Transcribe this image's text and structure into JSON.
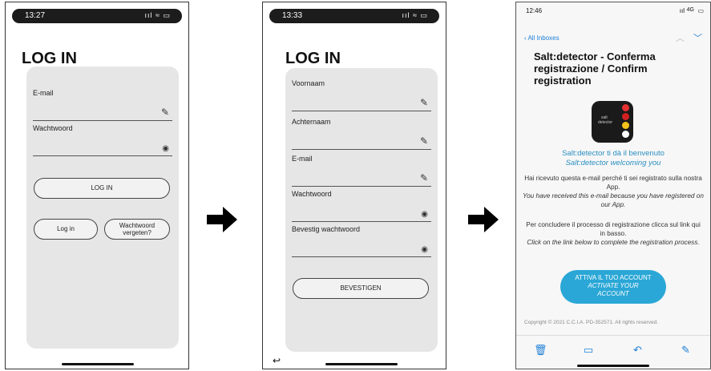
{
  "screen1": {
    "time": "13:27",
    "status_icons": "ııl ≈ ▭",
    "title": "LOG IN",
    "fields": [
      {
        "label": "E-mail",
        "icon": "edit-icon"
      },
      {
        "label": "Wachtwoord",
        "icon": "eye-icon"
      }
    ],
    "login_button": "LOG IN",
    "login_link": "Log in",
    "forgot_line1": "Wachtwoord",
    "forgot_line2": "vergeten?"
  },
  "screen2": {
    "time": "13:33",
    "status_icons": "ııl ≈ ▭",
    "title": "LOG IN",
    "fields": [
      {
        "label": "Voornaam",
        "icon": "edit-icon"
      },
      {
        "label": "Achternaam",
        "icon": "edit-icon"
      },
      {
        "label": "E-mail",
        "icon": "edit-icon"
      },
      {
        "label": "Wachtwoord",
        "icon": "eye-icon"
      },
      {
        "label": "Bevestig wachtwoord",
        "icon": "eye-icon"
      }
    ],
    "confirm_button": "BEVESTIGEN",
    "back_glyph": "↩"
  },
  "mail": {
    "time": "12:46",
    "signal": "4G",
    "back_label": "All Inboxes",
    "subject": "Salt:detector - Conferma registrazione / Confirm registration",
    "logo_text_line1": "salt",
    "logo_text_line2": "detector",
    "welcome_it": "Salt:detector ti dà il benvenuto",
    "welcome_en": "Salt:detector welcoming you",
    "para1_it": "Hai ricevuto questa e-mail perché ti sei registrato sulla nostra App.",
    "para1_en": "You have received this e-mail because you have registered on our App.",
    "para2_it": "Per concludere il processo di registrazione clicca sul link qui in basso.",
    "para2_en": "Click on the link below to complete the registration process.",
    "cta_line1": "ATTIVA IL TUO ACCOUNT",
    "cta_line2": "ACTIVATE YOUR",
    "cta_line3": "ACCOUNT",
    "footer": "Copyright © 2021 C.C.I.A. PD-352571. All rights reserved."
  },
  "colors": {
    "accent": "#2aa7d6",
    "link": "#1e7fd6",
    "card": "#e6e6e6"
  }
}
